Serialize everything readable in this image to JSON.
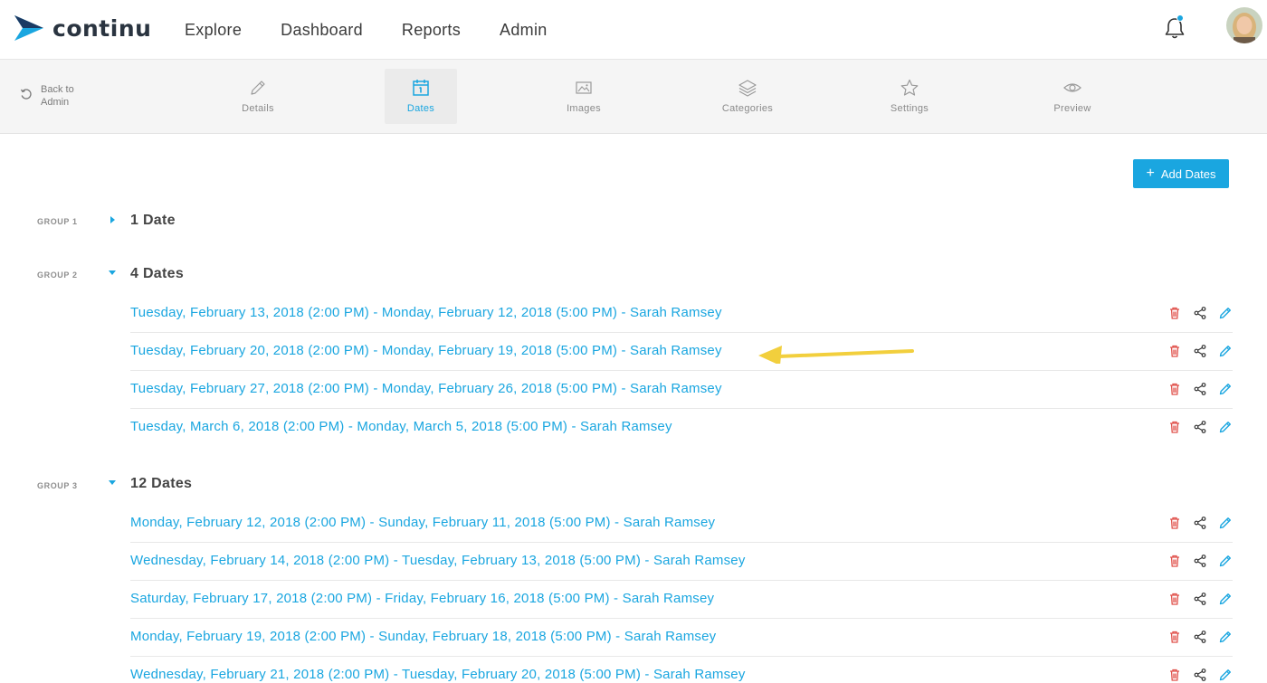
{
  "brand": {
    "name": "continu",
    "accent": "#1aa6e0"
  },
  "nav": {
    "links": [
      "Explore",
      "Dashboard",
      "Reports",
      "Admin"
    ]
  },
  "subbar": {
    "back_label": "Back to Admin",
    "steps": [
      {
        "label": "Details",
        "icon": "pencil-icon"
      },
      {
        "label": "Dates",
        "icon": "calendar-icon"
      },
      {
        "label": "Images",
        "icon": "image-icon"
      },
      {
        "label": "Categories",
        "icon": "layers-icon"
      },
      {
        "label": "Settings",
        "icon": "star-icon"
      },
      {
        "label": "Preview",
        "icon": "eye-icon"
      }
    ],
    "active_step": "Dates"
  },
  "main": {
    "add_button_label": "Add Dates",
    "groups": [
      {
        "label": "GROUP 1",
        "title": "1 Date",
        "expanded": false,
        "dates": []
      },
      {
        "label": "GROUP 2",
        "title": "4 Dates",
        "expanded": true,
        "dates": [
          "Tuesday, February 13, 2018 (2:00 PM) - Monday, February 12, 2018 (5:00 PM) - Sarah Ramsey",
          "Tuesday, February 20, 2018 (2:00 PM) - Monday, February 19, 2018 (5:00 PM) - Sarah Ramsey",
          "Tuesday, February 27, 2018 (2:00 PM) - Monday, February 26, 2018 (5:00 PM) - Sarah Ramsey",
          "Tuesday, March 6, 2018 (2:00 PM) - Monday, March 5, 2018 (5:00 PM) - Sarah Ramsey"
        ]
      },
      {
        "label": "GROUP 3",
        "title": "12 Dates",
        "expanded": true,
        "dates": [
          "Monday, February 12, 2018 (2:00 PM) - Sunday, February 11, 2018 (5:00 PM) - Sarah Ramsey",
          "Wednesday, February 14, 2018 (2:00 PM) - Tuesday, February 13, 2018 (5:00 PM) - Sarah Ramsey",
          "Saturday, February 17, 2018 (2:00 PM) - Friday, February 16, 2018 (5:00 PM) - Sarah Ramsey",
          "Monday, February 19, 2018 (2:00 PM) - Sunday, February 18, 2018 (5:00 PM) - Sarah Ramsey",
          "Wednesday, February 21, 2018 (2:00 PM) - Tuesday, February 20, 2018 (5:00 PM) - Sarah Ramsey"
        ]
      }
    ]
  },
  "colors": {
    "link": "#1aa6e0",
    "delete": "#e0504a",
    "annotation_arrow": "#f2cf3d"
  }
}
